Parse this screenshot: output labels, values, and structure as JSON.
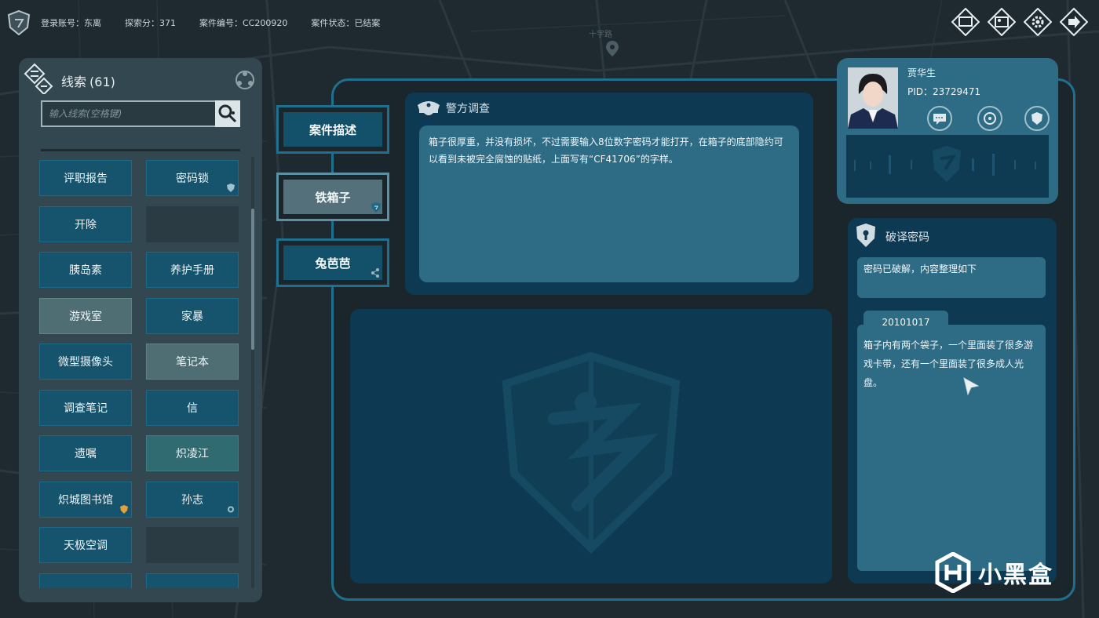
{
  "status_bar": {
    "account_label": "登录账号：东离",
    "score_label": "探索分：371",
    "case_id_label": "案件编号：CC200920",
    "case_status_label": "案件状态：已结案"
  },
  "map": {
    "street_label": "十字路"
  },
  "top_icons": [
    "window-icon",
    "image-icon",
    "gear-icon",
    "exit-icon"
  ],
  "clue_panel": {
    "title": "线索",
    "count": "(61)",
    "search_placeholder": "输入线索(空格键)",
    "items": [
      {
        "label": "评职报告",
        "style": "normal",
        "badge": ""
      },
      {
        "label": "密码锁",
        "style": "normal",
        "badge": "shield-icon"
      },
      {
        "label": "开除",
        "style": "normal",
        "badge": ""
      },
      {
        "label": "",
        "style": "empty",
        "badge": ""
      },
      {
        "label": "胰岛素",
        "style": "normal",
        "badge": ""
      },
      {
        "label": "养护手册",
        "style": "normal",
        "badge": ""
      },
      {
        "label": "游戏室",
        "style": "light",
        "badge": ""
      },
      {
        "label": "家暴",
        "style": "normal",
        "badge": ""
      },
      {
        "label": "微型摄像头",
        "style": "normal",
        "badge": ""
      },
      {
        "label": "笔记本",
        "style": "light",
        "badge": ""
      },
      {
        "label": "调查笔记",
        "style": "normal",
        "badge": ""
      },
      {
        "label": "信",
        "style": "normal",
        "badge": ""
      },
      {
        "label": "遗嘱",
        "style": "normal",
        "badge": ""
      },
      {
        "label": "炽凌江",
        "style": "teal",
        "badge": ""
      },
      {
        "label": "炽城图书馆",
        "style": "normal",
        "badge": "gold-badge-icon"
      },
      {
        "label": "孙志",
        "style": "normal",
        "badge": "dot-icon"
      },
      {
        "label": "天极空调",
        "style": "normal",
        "badge": ""
      },
      {
        "label": "",
        "style": "empty",
        "badge": ""
      },
      {
        "label": "",
        "style": "normal",
        "badge": ""
      },
      {
        "label": "",
        "style": "normal",
        "badge": ""
      }
    ]
  },
  "tabs": [
    {
      "label": "案件描述",
      "active": false
    },
    {
      "label": "铁箱子",
      "active": true
    },
    {
      "label": "兔芭芭",
      "active": false
    }
  ],
  "description": {
    "title": "警方调查",
    "text": "箱子很厚重，并没有损坏，不过需要输入8位数字密码才能打开，在箱子的底部隐约可以看到未被完全腐蚀的贴纸，上面写有“CF41706”的字样。"
  },
  "profile": {
    "name": "贾华生",
    "pid": "PID：23729471"
  },
  "decode": {
    "title": "破译密码",
    "status": "密码已破解，内容整理如下",
    "code": "20101017",
    "content": "箱子内有两个袋子，一个里面装了很多游戏卡带，还有一个里面装了很多成人光盘。"
  },
  "watermark": {
    "text": "小黑盒"
  },
  "colors": {
    "panel_blue": "#0d3a52",
    "accent_blue": "#2e6b84",
    "frame_blue": "#1f6f8e",
    "clue_button": "#16546e"
  }
}
